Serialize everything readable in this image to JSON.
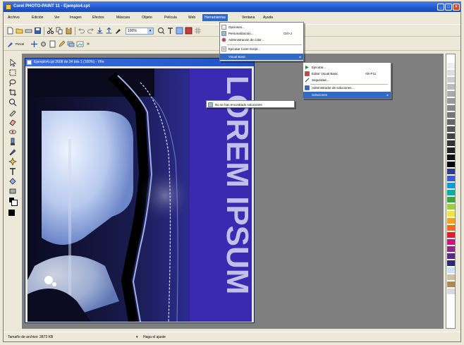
{
  "window": {
    "title": "Corel PHOTO-PAINT 11 - Ejemplo4.cpt",
    "minimize": "_",
    "maximize": "□",
    "close": "×"
  },
  "menubar": {
    "items": [
      "Archivo",
      "Edición",
      "Ver",
      "Imagen",
      "Efectos",
      "Máscara",
      "Objeto",
      "Película",
      "Web",
      "Herramientas",
      "Ventana",
      "Ayuda"
    ],
    "active": "Herramientas"
  },
  "toolbar": {
    "zoom_value": "100%",
    "toolbar2_label": "Pincel"
  },
  "document": {
    "title": "Ejemplo4.cpt 2608 de 34 bits 1 (100%) - Vfm"
  },
  "canvas": {
    "overlay_text": "LOREM IPSUM"
  },
  "menus": {
    "herramientas": {
      "items": [
        {
          "label": "Opciones...",
          "shortcut": "",
          "icon": "options-icon"
        },
        {
          "label": "Personalización...",
          "shortcut": "Ctrl+J",
          "icon": "customize-icon"
        },
        {
          "label": "Administración de color...",
          "shortcut": "",
          "icon": "color-management-icon"
        },
        {
          "label": "Ejecutar Corel Script...",
          "shortcut": "",
          "icon": "script-icon"
        },
        {
          "label": "Visual Basic",
          "shortcut": "",
          "icon": "",
          "submenu": true
        }
      ]
    },
    "visual_basic": {
      "items": [
        {
          "label": "Ejecutar...",
          "shortcut": "",
          "icon": "run-icon"
        },
        {
          "label": "Editor Visual Basic",
          "shortcut": "Alt+F11",
          "icon": "vb-editor-icon"
        },
        {
          "label": "Seguridad...",
          "shortcut": "",
          "icon": "security-icon"
        },
        {
          "label": "Administrador de soluciones...",
          "shortcut": "",
          "icon": "solutions-icon"
        },
        {
          "label": "Soluciones",
          "shortcut": "",
          "icon": "",
          "submenu": true
        }
      ]
    },
    "soluciones": {
      "items": [
        {
          "label": "No se han encontrado soluciones",
          "icon": "solutions-item-icon"
        }
      ]
    }
  },
  "status": {
    "file_size": "Tamaño de archivo: 2873 KB",
    "hint": "Haga el ajuste"
  },
  "palette_colors": [
    "#ffffff",
    "#eeeeee",
    "#dddddd",
    "#cccccc",
    "#bbbbbb",
    "#aaaaaa",
    "#999999",
    "#888888",
    "#777777",
    "#666666",
    "#555555",
    "#444444",
    "#333333",
    "#222222",
    "#111111",
    "#000000",
    "#2e3b8f",
    "#3c5ad9",
    "#00a0e0",
    "#00b0a0",
    "#3aa83a",
    "#9ccf3a",
    "#f2e53a",
    "#f7a21b",
    "#ee6a1e",
    "#e21b2a",
    "#c7177e",
    "#8b2a8c",
    "#5d2a8c",
    "#2b2b6e",
    "#cfe2f3",
    "#c9c2a4",
    "#b08850",
    "#d9d9d9"
  ]
}
